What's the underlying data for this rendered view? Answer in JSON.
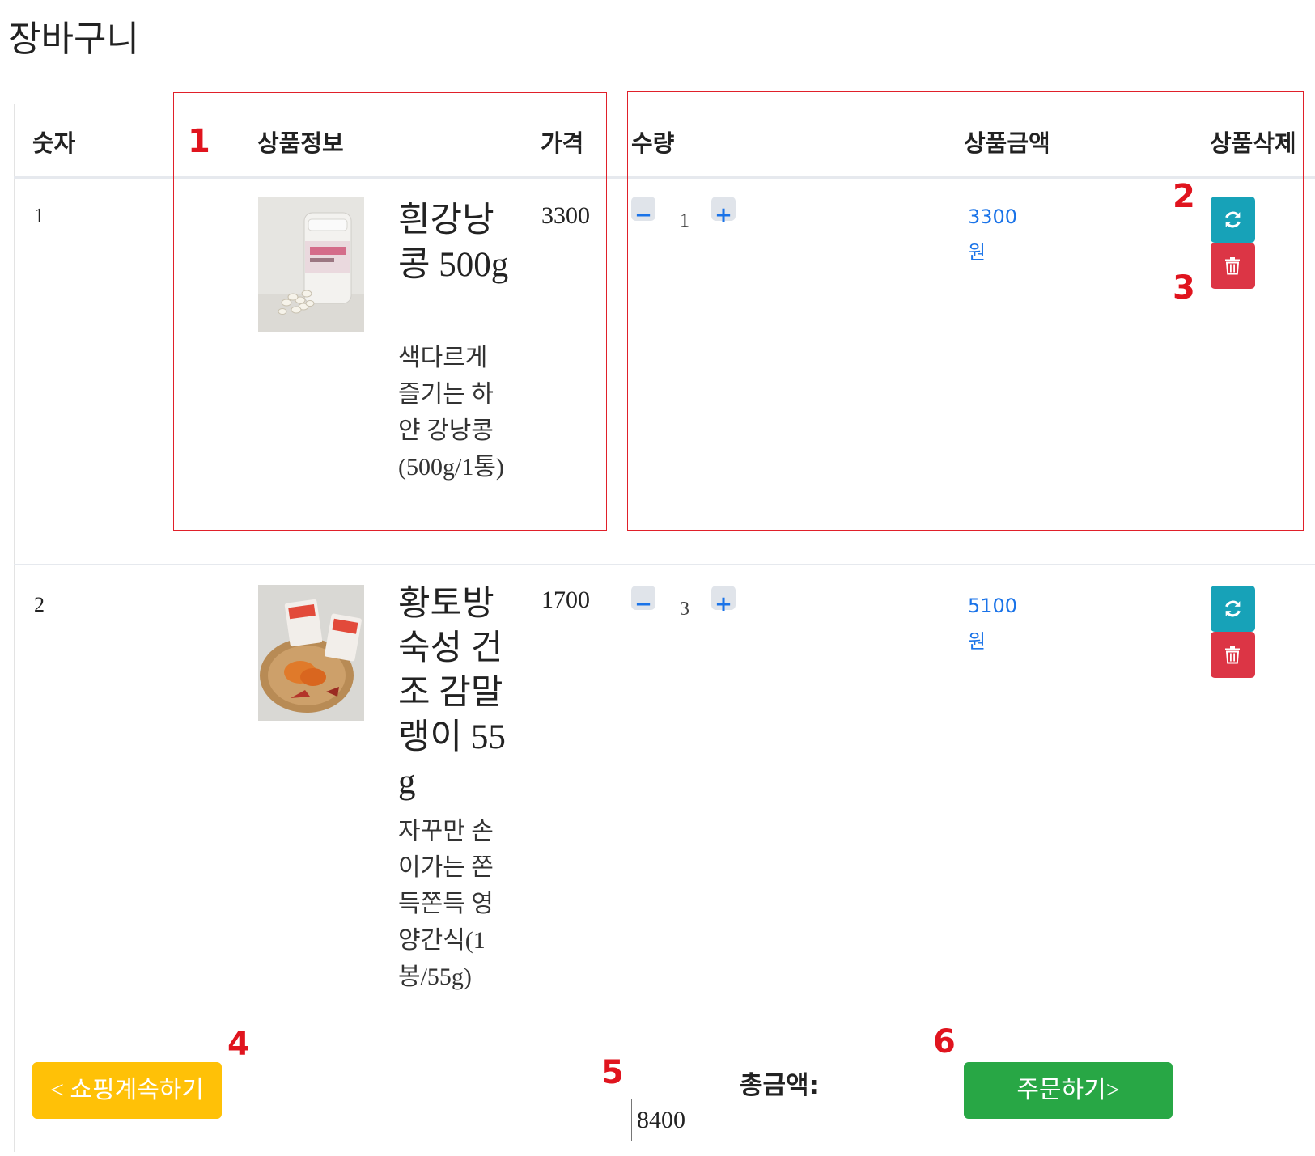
{
  "page": {
    "title": "장바구니"
  },
  "table": {
    "headers": {
      "no": "숫자",
      "info": "상품정보",
      "price": "가격",
      "qty": "수량",
      "amount": "상품금액",
      "delete": "상품삭제"
    }
  },
  "items": [
    {
      "no": "1",
      "name": "흰강낭콩 500g",
      "desc": "색다르게 즐기는 하얀 강낭콩(500g/1통)",
      "price": "3300",
      "qty": "1",
      "amount": "3300",
      "unit": "원",
      "image": "white-kidney-bean-jar"
    },
    {
      "no": "2",
      "name": "황토방 숙성 건조 감말랭이 55g",
      "desc": "자꾸만 손이가는 쫀득쫀득 영양간식(1봉/55g)",
      "price": "1700",
      "qty": "3",
      "amount": "5100",
      "unit": "원",
      "image": "dried-persimmon-pack"
    }
  ],
  "qty_controls": {
    "minus": "−",
    "plus": "+"
  },
  "icons": {
    "refresh": "refresh-icon",
    "delete": "trash-icon"
  },
  "footer": {
    "continue_label": "< 쇼핑계속하기",
    "total_label": "총금액:",
    "total_value": "8400",
    "order_label": "주문하기>"
  },
  "annotations": [
    "1",
    "2",
    "3",
    "4",
    "5",
    "6"
  ],
  "colors": {
    "refresh_button": "#17a2b8",
    "delete_button": "#dc3545",
    "continue_button": "#ffc107",
    "order_button": "#28a745",
    "amount_text": "#1a73e8",
    "annotation_red": "#e0141e"
  }
}
